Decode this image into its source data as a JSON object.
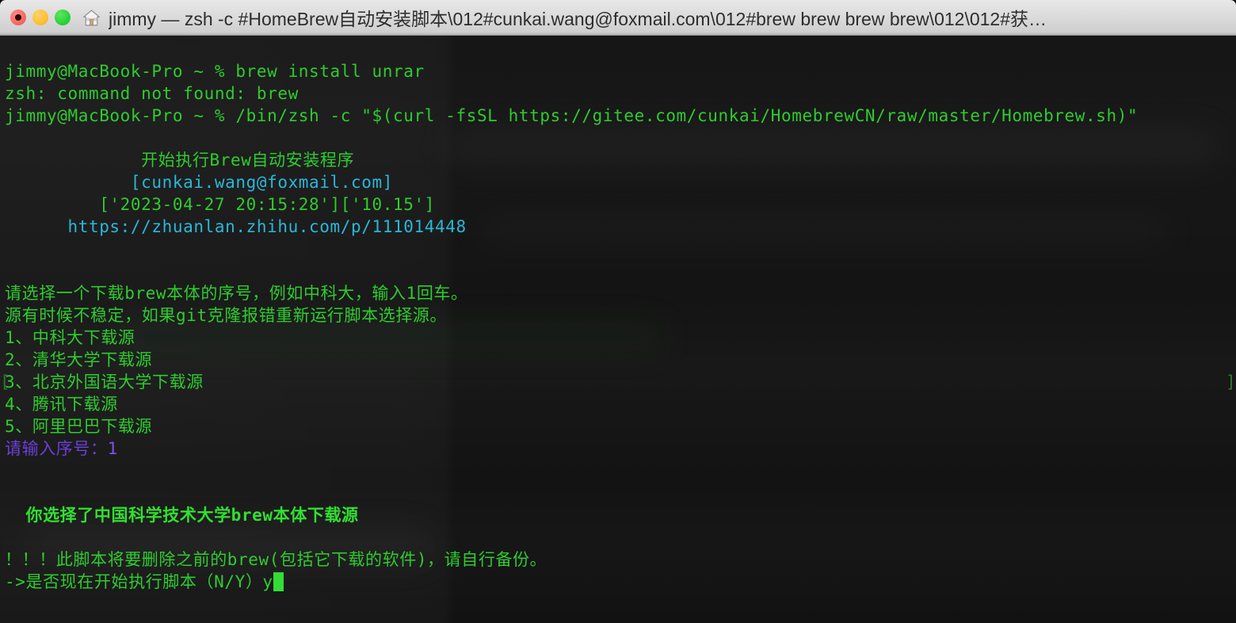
{
  "window": {
    "title": "jimmy — zsh -c #HomeBrew自动安装脚本\\012#cunkai.wang@foxmail.com\\012#brew brew brew brew\\012\\012#获…",
    "traffic_lights": {
      "close": "close-button",
      "minimize": "minimize-button",
      "zoom": "zoom-button"
    },
    "proxy_icon": "home-icon"
  },
  "terminal": {
    "colors": {
      "background": "#101010",
      "foreground": "#2ecc2e",
      "cyan": "#29b8d8",
      "purple": "#6a3fd6",
      "cursor": "#33dd33"
    },
    "lines": [
      {
        "text": "jimmy@MacBook-Pro ~ % brew install unrar",
        "color": "green"
      },
      {
        "text": "zsh: command not found: brew",
        "color": "green"
      },
      {
        "text": "jimmy@MacBook-Pro ~ % /bin/zsh -c \"$(curl -fsSL https://gitee.com/cunkai/HomebrewCN/raw/master/Homebrew.sh)\"",
        "color": "green"
      },
      {
        "text": "",
        "color": "green"
      },
      {
        "text": "             开始执行Brew自动安装程序",
        "color": "green"
      },
      {
        "text": "            [cunkai.wang@foxmail.com]",
        "color": "cyan"
      },
      {
        "text": "         ['2023-04-27 20:15:28']['10.15']",
        "color": "green"
      },
      {
        "text": "      https://zhuanlan.zhihu.com/p/111014448",
        "color": "cyan"
      },
      {
        "text": "",
        "color": "green"
      },
      {
        "text": "",
        "color": "green"
      },
      {
        "text": "请选择一个下载brew本体的序号，例如中科大，输入1回车。",
        "color": "green"
      },
      {
        "text": "源有时候不稳定，如果git克隆报错重新运行脚本选择源。",
        "color": "green"
      },
      {
        "text": "1、中科大下载源",
        "color": "green"
      },
      {
        "text": "2、清华大学下载源",
        "color": "green"
      },
      {
        "text": "3、北京外国语大学下载源",
        "color": "green"
      },
      {
        "text": "4、腾讯下载源",
        "color": "green"
      },
      {
        "text": "5、阿里巴巴下载源",
        "color": "green"
      },
      {
        "text": "请输入序号：",
        "value": "1",
        "color": "purple"
      },
      {
        "text": "",
        "color": "green"
      },
      {
        "text": "",
        "color": "green"
      },
      {
        "text": "  你选择了中国科学技术大学brew本体下载源",
        "color": "green-bold"
      },
      {
        "text": "",
        "color": "green"
      },
      {
        "text": "！！！此脚本将要删除之前的brew(包括它下载的软件)，请自行备份。",
        "color": "green"
      },
      {
        "text": "->是否现在开始执行脚本（N/Y）",
        "value": "y",
        "color": "green",
        "cursor": true
      }
    ],
    "artifacts": {
      "left_bracket": "[",
      "right_bracket": "]"
    }
  }
}
